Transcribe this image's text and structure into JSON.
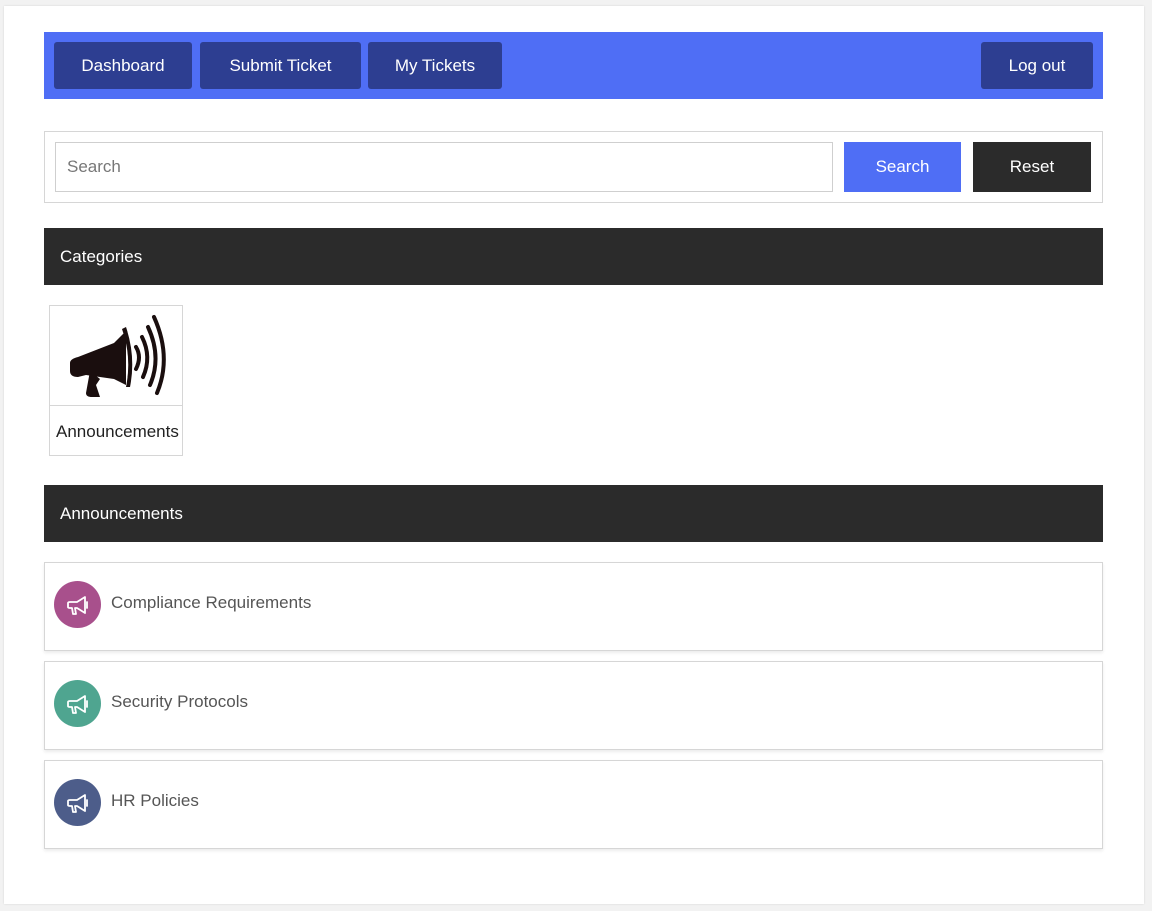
{
  "nav": {
    "dashboard": "Dashboard",
    "submit_ticket": "Submit Ticket",
    "my_tickets": "My Tickets",
    "logout": "Log out"
  },
  "search": {
    "placeholder": "Search",
    "value": "",
    "search_label": "Search",
    "reset_label": "Reset"
  },
  "categories": {
    "header": "Categories",
    "items": [
      {
        "label": "Announcements",
        "icon": "megaphone-icon"
      }
    ]
  },
  "announcements": {
    "header": "Announcements",
    "items": [
      {
        "title": "Compliance Requirements",
        "icon": "megaphone-icon",
        "color": "#a8508c"
      },
      {
        "title": "Security Protocols",
        "icon": "megaphone-icon",
        "color": "#4fa590"
      },
      {
        "title": "HR Policies",
        "icon": "megaphone-icon",
        "color": "#4d5d8a"
      }
    ]
  },
  "colors": {
    "nav_bg": "#4f6ef5",
    "nav_button": "#2d3e91",
    "search_button": "#4f6ef5",
    "reset_button": "#2b2b2b",
    "section_header": "#2b2b2b"
  }
}
